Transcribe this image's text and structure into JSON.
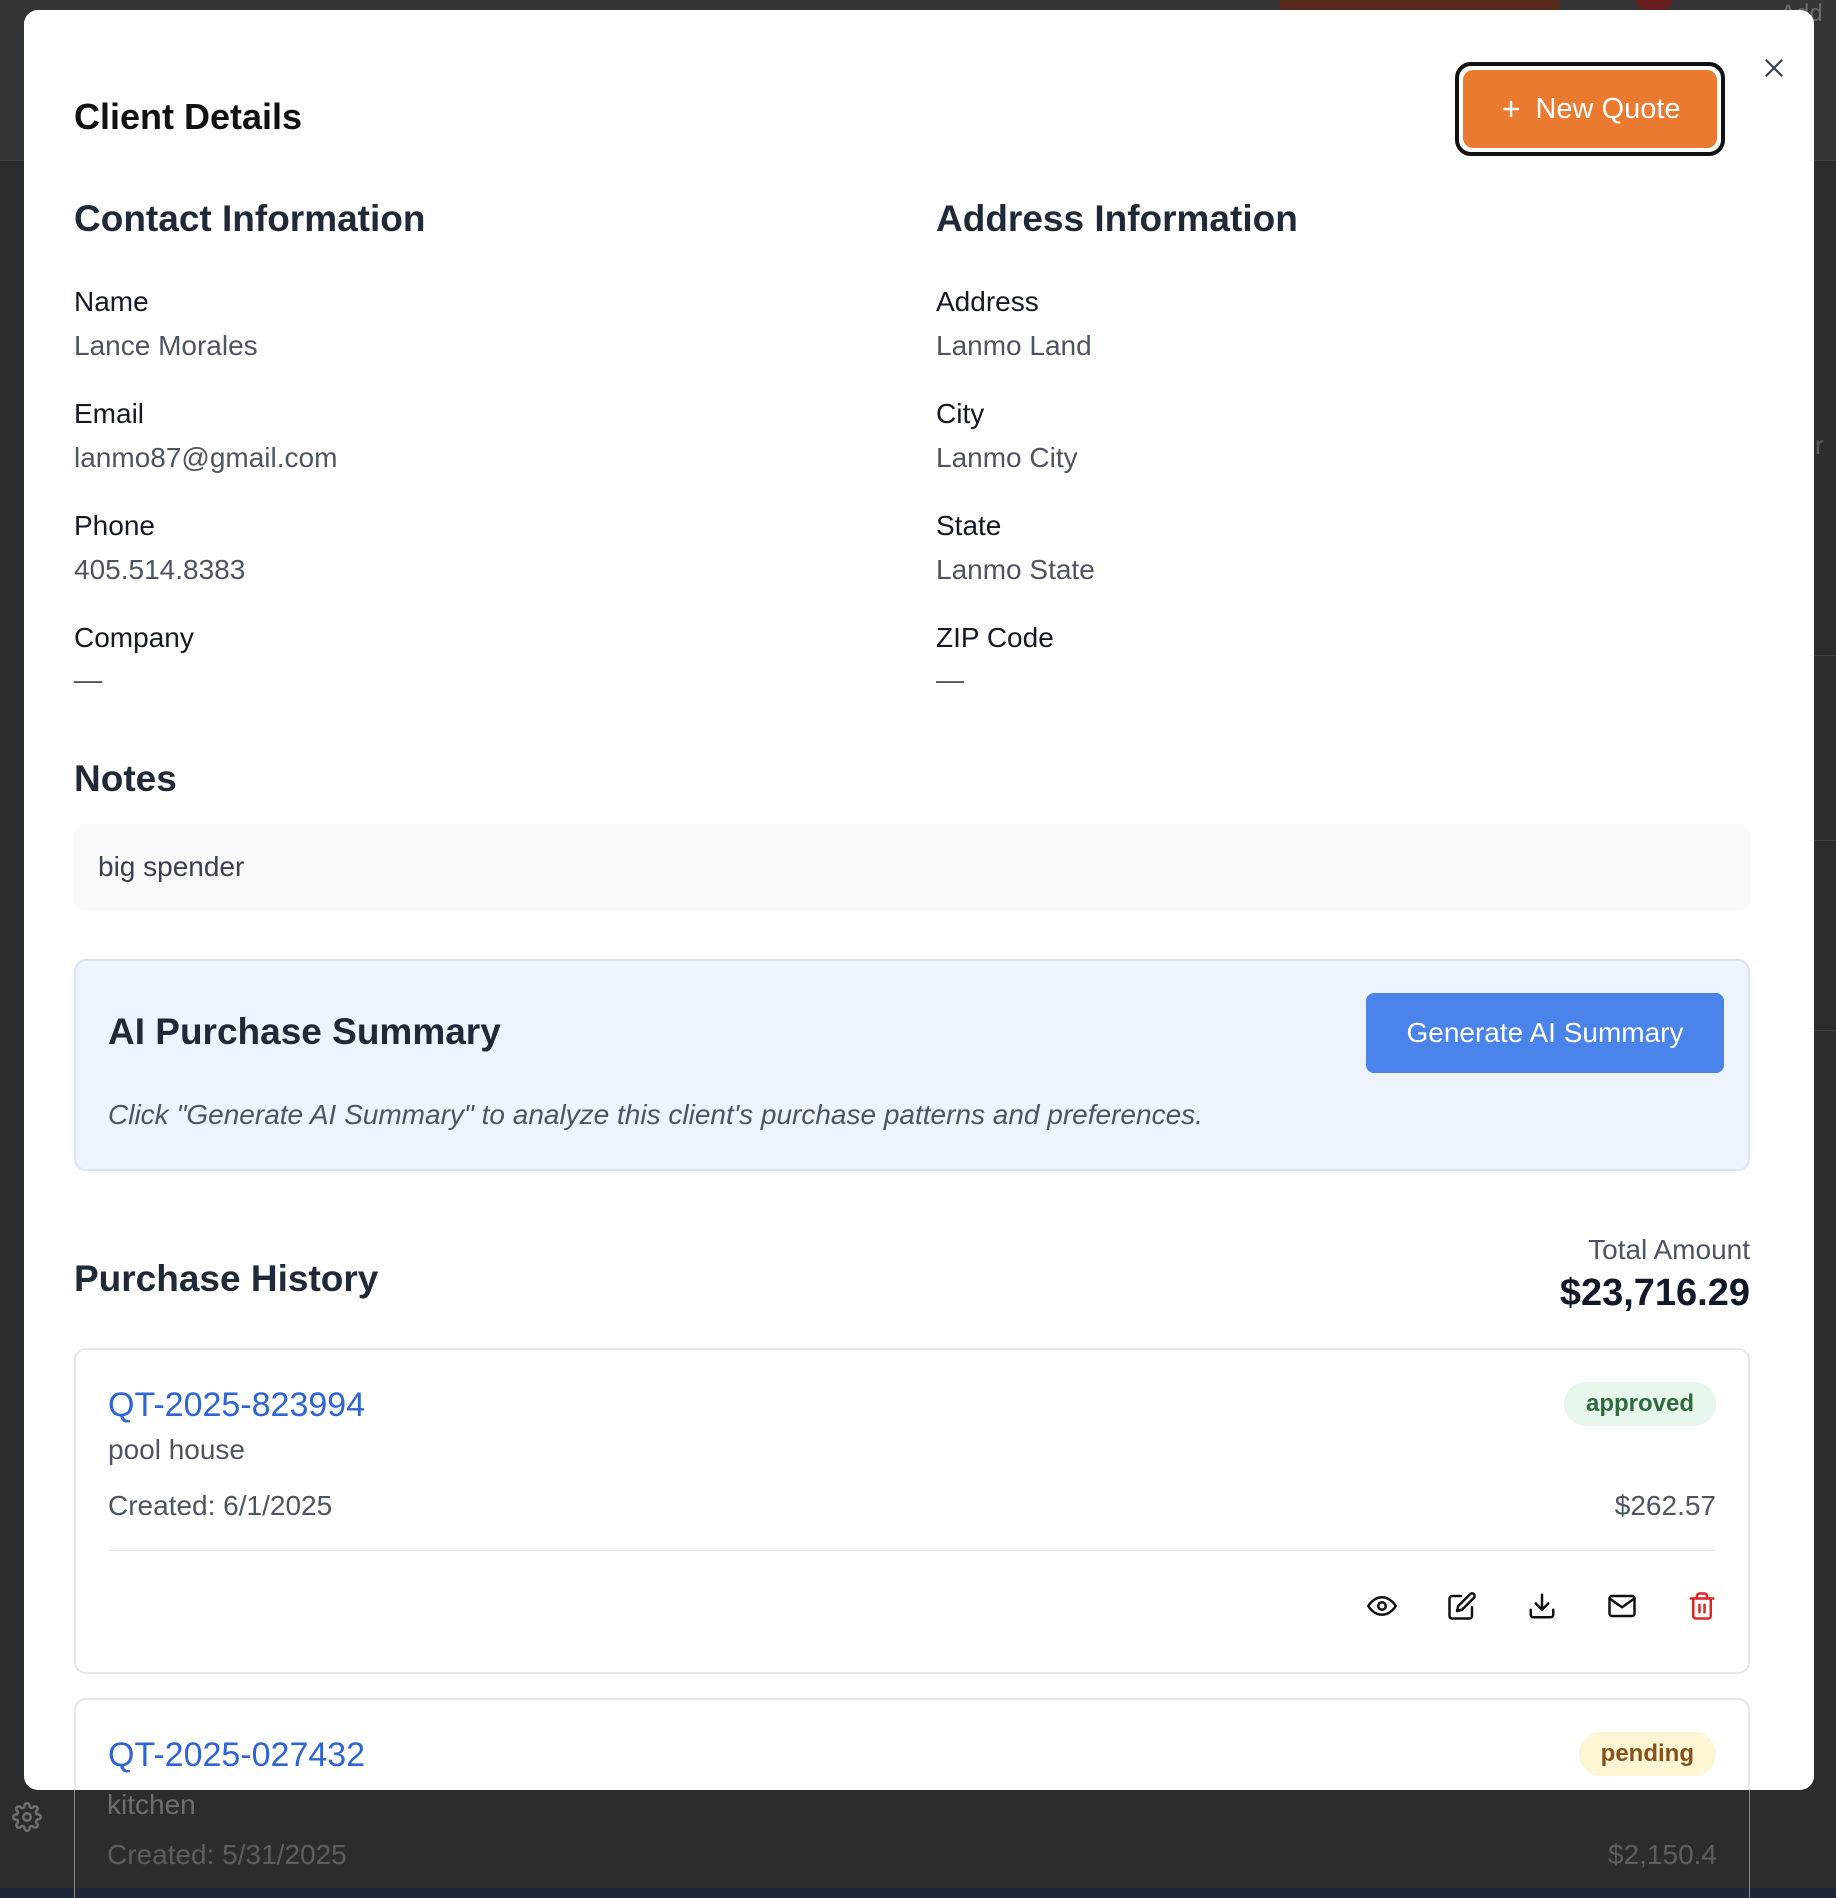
{
  "background": {
    "partial_text_right": "Add",
    "partial_text_side": "r"
  },
  "modal": {
    "title": "Client Details",
    "new_quote_label": "New Quote",
    "close_icon": "close-icon"
  },
  "contact": {
    "heading": "Contact Information",
    "fields": [
      {
        "label": "Name",
        "value": "Lance Morales"
      },
      {
        "label": "Email",
        "value": "lanmo87@gmail.com"
      },
      {
        "label": "Phone",
        "value": "405.514.8383"
      },
      {
        "label": "Company",
        "value": "—"
      }
    ]
  },
  "address": {
    "heading": "Address Information",
    "fields": [
      {
        "label": "Address",
        "value": "Lanmo Land"
      },
      {
        "label": "City",
        "value": "Lanmo City"
      },
      {
        "label": "State",
        "value": "Lanmo State"
      },
      {
        "label": "ZIP Code",
        "value": "—"
      }
    ]
  },
  "notes": {
    "heading": "Notes",
    "text": "big spender"
  },
  "ai_summary": {
    "heading": "AI Purchase Summary",
    "button_label": "Generate AI Summary",
    "hint": "Click \"Generate AI Summary\" to analyze this client's purchase patterns and preferences."
  },
  "purchase_history": {
    "heading": "Purchase History",
    "total_label": "Total Amount",
    "total_value": "$23,716.29",
    "quotes": [
      {
        "id": "QT-2025-823994",
        "description": "pool house",
        "created": "Created: 6/1/2025",
        "amount": "$262.57",
        "status": "approved"
      },
      {
        "id": "QT-2025-027432",
        "description": "kitchen",
        "created": "Created: 5/31/2025",
        "amount": "$2,150.4",
        "status": "pending"
      }
    ]
  },
  "colors": {
    "accent_orange": "#ea7a2f",
    "primary_blue": "#4a84ea",
    "link_blue": "#2f64d6",
    "delete_red": "#dc2626"
  }
}
